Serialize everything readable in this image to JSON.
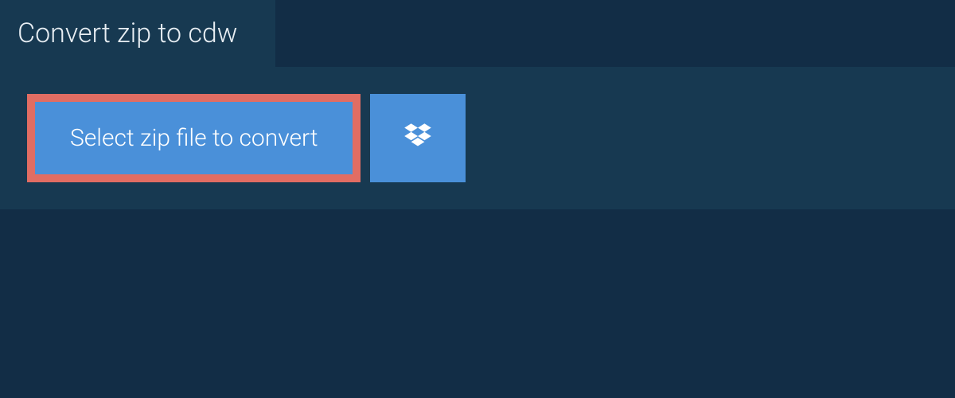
{
  "header": {
    "title": "Convert zip to cdw"
  },
  "actions": {
    "select_file_label": "Select zip file to convert",
    "dropbox_icon": "dropbox-icon"
  },
  "colors": {
    "page_background": "#122d46",
    "panel_background": "#173951",
    "button_background": "#4a90d9",
    "highlight_border": "#e16d63",
    "text_light": "#ffffff"
  }
}
